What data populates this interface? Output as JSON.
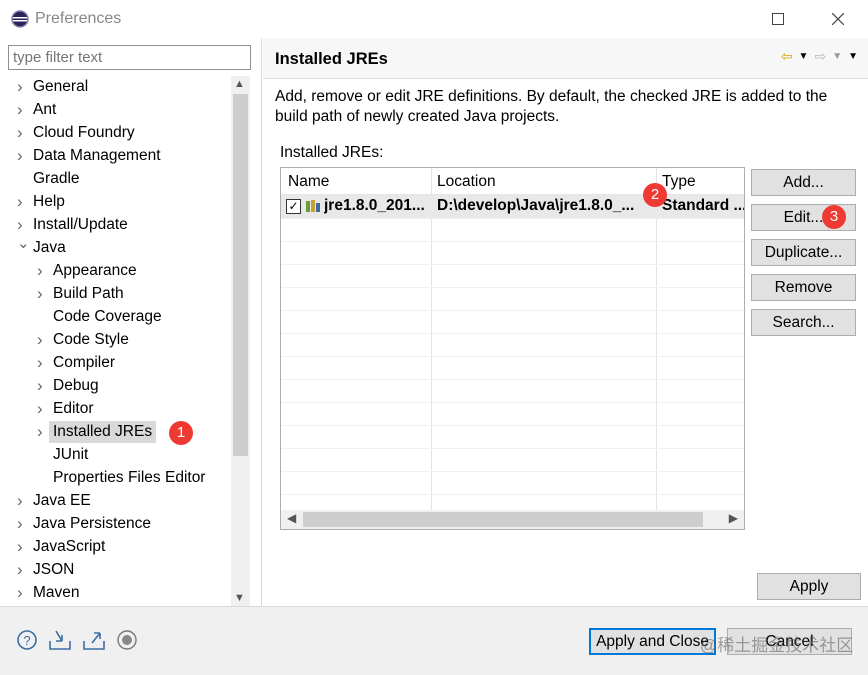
{
  "window": {
    "title": "Preferences"
  },
  "filter": {
    "placeholder": "type filter text"
  },
  "tree": [
    {
      "label": "General",
      "expandable": true,
      "level": 0
    },
    {
      "label": "Ant",
      "expandable": true,
      "level": 0
    },
    {
      "label": "Cloud Foundry",
      "expandable": true,
      "level": 0
    },
    {
      "label": "Data Management",
      "expandable": true,
      "level": 0
    },
    {
      "label": "Gradle",
      "expandable": false,
      "level": 0
    },
    {
      "label": "Help",
      "expandable": true,
      "level": 0
    },
    {
      "label": "Install/Update",
      "expandable": true,
      "level": 0
    },
    {
      "label": "Java",
      "expandable": true,
      "expanded": true,
      "level": 0
    },
    {
      "label": "Appearance",
      "expandable": true,
      "level": 1
    },
    {
      "label": "Build Path",
      "expandable": true,
      "level": 1
    },
    {
      "label": "Code Coverage",
      "expandable": false,
      "level": 1
    },
    {
      "label": "Code Style",
      "expandable": true,
      "level": 1
    },
    {
      "label": "Compiler",
      "expandable": true,
      "level": 1
    },
    {
      "label": "Debug",
      "expandable": true,
      "level": 1
    },
    {
      "label": "Editor",
      "expandable": true,
      "level": 1
    },
    {
      "label": "Installed JREs",
      "expandable": true,
      "level": 1,
      "selected": true
    },
    {
      "label": "JUnit",
      "expandable": false,
      "level": 1
    },
    {
      "label": "Properties Files Editor",
      "expandable": false,
      "level": 1
    },
    {
      "label": "Java EE",
      "expandable": true,
      "level": 0
    },
    {
      "label": "Java Persistence",
      "expandable": true,
      "level": 0
    },
    {
      "label": "JavaScript",
      "expandable": true,
      "level": 0
    },
    {
      "label": "JSON",
      "expandable": true,
      "level": 0
    },
    {
      "label": "Maven",
      "expandable": true,
      "level": 0
    }
  ],
  "page": {
    "title": "Installed JREs",
    "description": "Add, remove or edit JRE definitions. By default, the checked JRE is added to the build path of newly created Java projects.",
    "section_label": "Installed JREs:"
  },
  "table": {
    "columns": [
      "Name",
      "Location",
      "Type"
    ],
    "rows": [
      {
        "checked": true,
        "name": "jre1.8.0_201...",
        "location": "D:\\develop\\Java\\jre1.8.0_...",
        "type": "Standard ..."
      }
    ]
  },
  "buttons": {
    "add": "Add...",
    "edit": "Edit...",
    "duplicate": "Duplicate...",
    "remove": "Remove",
    "search": "Search...",
    "apply": "Apply",
    "apply_close": "Apply and Close",
    "cancel": "Cancel"
  },
  "badges": {
    "one": "1",
    "two": "2",
    "three": "3"
  },
  "watermark": "@稀土掘金技术社区",
  "colors": {
    "badge": "#ee3a33",
    "focus": "#0078d7",
    "selection": "#d9d9d9"
  }
}
